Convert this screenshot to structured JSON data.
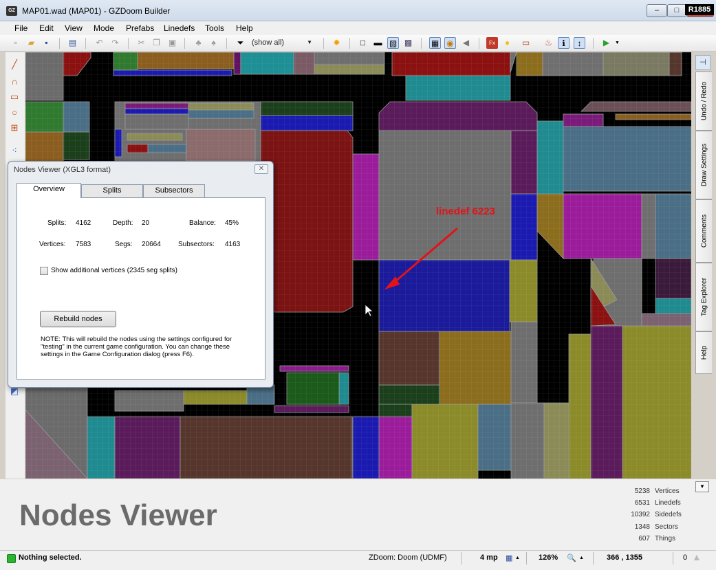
{
  "window": {
    "title": "MAP01.wad (MAP01) - GZDoom Builder",
    "app_icon": "GZ",
    "revision": "R1885",
    "minimize": "‒",
    "maximize": "□",
    "close": "✕"
  },
  "menu": {
    "items": [
      "File",
      "Edit",
      "View",
      "Mode",
      "Prefabs",
      "Linedefs",
      "Tools",
      "Help"
    ]
  },
  "toolbar": {
    "filter_value": "(show all)"
  },
  "right_dock": {
    "tabs": [
      "Undo / Redo",
      "Draw Settings",
      "Comments",
      "Tag Explorer",
      "Help"
    ]
  },
  "map": {
    "annotation": "linedef 6223"
  },
  "dialog": {
    "title": "Nodes Viewer (XGL3 format)",
    "tabs": [
      "Overview",
      "Splits",
      "Subsectors"
    ],
    "stats": {
      "splits_label": "Splits:",
      "splits_value": "4162",
      "depth_label": "Depth:",
      "depth_value": "20",
      "balance_label": "Balance:",
      "balance_value": "45%",
      "vertices_label": "Vertices:",
      "vertices_value": "7583",
      "segs_label": "Segs:",
      "segs_value": "20664",
      "subsectors_label": "Subsectors:",
      "subsectors_value": "4163"
    },
    "checkbox_label": "Show additional vertices (2345 seg splits)",
    "checkbox_checked": false,
    "rebuild_button": "Rebuild nodes",
    "note": "NOTE: This will rebuild the nodes using the settings configured for \"testing\" in the current game configuration. You can change these settings in the Game Configuration dialog (press F6)."
  },
  "bottom_panel": {
    "title": "Nodes Viewer",
    "map_stats": [
      {
        "value": "5238",
        "label": "Vertices"
      },
      {
        "value": "6531",
        "label": "Linedefs"
      },
      {
        "value": "10392",
        "label": "Sidedefs"
      },
      {
        "value": "1348",
        "label": "Sectors"
      },
      {
        "value": "607",
        "label": "Things"
      }
    ]
  },
  "status": {
    "text": "Nothing selected.",
    "game_config": "ZDoom: Doom (UDMF)",
    "grid": "4 mp",
    "zoom": "126%",
    "coordinates": "366 , 1355",
    "count": "0"
  }
}
